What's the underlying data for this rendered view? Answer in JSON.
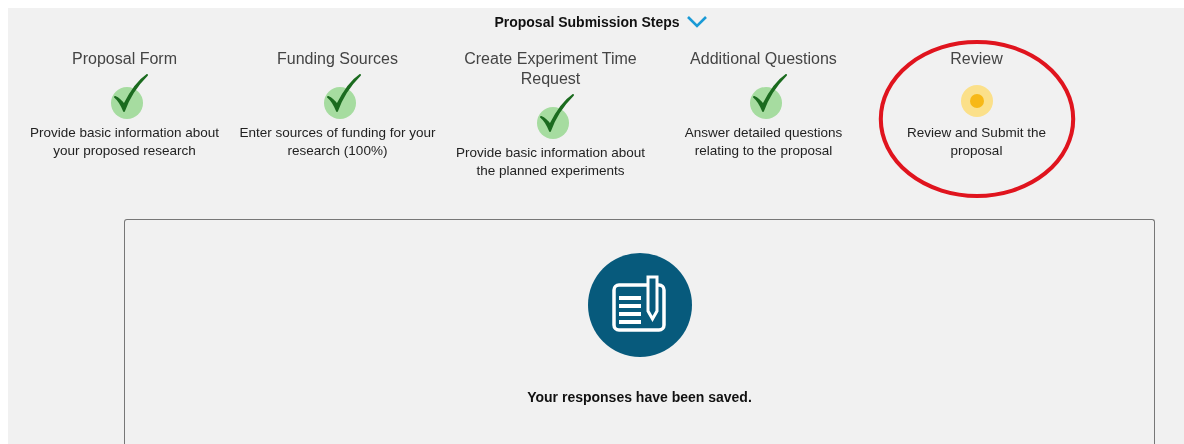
{
  "header": {
    "title": "Proposal Submission Steps",
    "expanded": true
  },
  "steps": [
    {
      "title": "Proposal Form",
      "completed": true,
      "description": "Provide basic information about your proposed research",
      "highlighted": false
    },
    {
      "title": "Funding Sources",
      "completed": true,
      "description": "Enter sources of funding for your research (100%)",
      "highlighted": false
    },
    {
      "title": "Create Experiment Time Request",
      "completed": true,
      "description": "Provide basic information about the planned experiments",
      "highlighted": false
    },
    {
      "title": "Additional Questions",
      "completed": true,
      "description": "Answer detailed questions relating to the proposal",
      "highlighted": false
    },
    {
      "title": "Review",
      "completed": false,
      "description": "Review and Submit the proposal",
      "highlighted": true
    }
  ],
  "panel": {
    "message": "Your responses have been saved."
  }
}
